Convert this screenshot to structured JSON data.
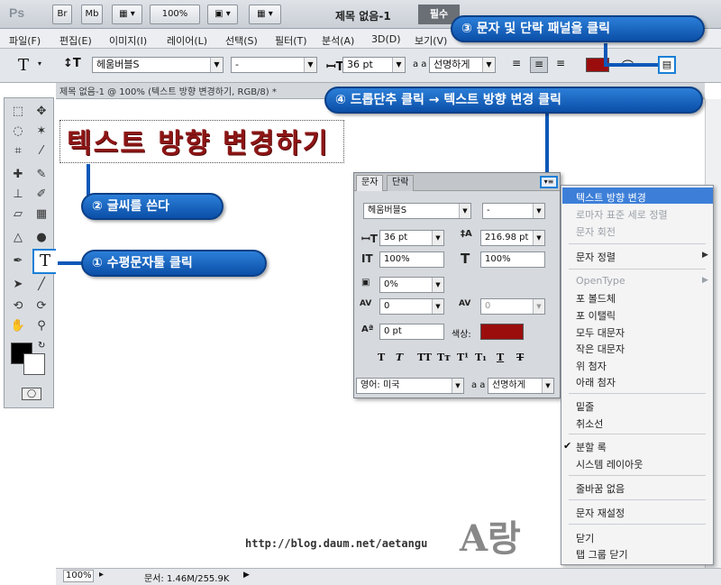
{
  "titlebar": {
    "logo": "Ps",
    "buttons": [
      "Br",
      "Mb",
      "▦ ▾",
      "100%",
      "▣ ▾",
      "▦ ▾"
    ],
    "doc_title": "제목 없음-1",
    "workspace": "필수"
  },
  "menu": [
    "파일(F)",
    "편집(E)",
    "이미지(I)",
    "레이어(L)",
    "선택(S)",
    "필터(T)",
    "분석(A)",
    "3D(D)",
    "보기(V)"
  ],
  "options": {
    "tool_glyph": "T",
    "font_family": "헤움버블S",
    "font_style": "-",
    "font_size": "36 pt",
    "aa_label": "a a",
    "antialias": "선명하게",
    "color": "#9b0d0d"
  },
  "document_tab": "제목 없음-1 @ 100% (텍스트 방향 변경하기, RGB/8) *",
  "sample_text": "텍스트 방향 변경하기",
  "callouts": {
    "c1": "① 수평문자툴 클릭",
    "c2": "② 글씨를 쓴다",
    "c3": "③ 문자 및 단락 패널을 클릭",
    "c4": "④ 드롭단추 클릭 → 텍스트 방향 변경 클릭"
  },
  "character_panel": {
    "tab_char": "문자",
    "tab_para": "단락",
    "font_family": "헤움버블S",
    "font_style": "-",
    "font_size": "36 pt",
    "leading": "216.98 pt",
    "vscale": "100%",
    "hscale": "100%",
    "tsume": "0%",
    "kerning": "0",
    "tracking": "0",
    "baseline": "0 pt",
    "color_label": "색상:",
    "color": "#9b0d0d",
    "language": "영어: 미국",
    "aa_label": "a a",
    "antialias": "선명하게"
  },
  "flyout_menu": {
    "groups": [
      [
        {
          "label": "텍스트 방향 변경",
          "state": "highlighted"
        },
        {
          "label": "로마자 표준 세로 정렬",
          "state": "disabled"
        },
        {
          "label": "문자 회전",
          "state": "disabled"
        }
      ],
      [
        {
          "label": "문자 정렬",
          "state": "submenu"
        }
      ],
      [
        {
          "label": "OpenType",
          "state": "submenu-disabled"
        },
        {
          "label": "포 볼드체",
          "state": "normal"
        },
        {
          "label": "포 이탤릭",
          "state": "normal"
        },
        {
          "label": "모두 대문자",
          "state": "normal"
        },
        {
          "label": "작은 대문자",
          "state": "normal"
        },
        {
          "label": "위 첨자",
          "state": "normal"
        },
        {
          "label": "아래 첨자",
          "state": "normal"
        }
      ],
      [
        {
          "label": "밑줄",
          "state": "normal"
        },
        {
          "label": "취소선",
          "state": "normal"
        }
      ],
      [
        {
          "label": "분할 록",
          "state": "checked"
        },
        {
          "label": "시스템 레이아웃",
          "state": "normal"
        }
      ],
      [
        {
          "label": "줄바꿈 없음",
          "state": "normal"
        }
      ],
      [
        {
          "label": "문자 재설정",
          "state": "normal"
        }
      ],
      [
        {
          "label": "닫기",
          "state": "normal"
        },
        {
          "label": "탭 그룹 닫기",
          "state": "normal"
        }
      ]
    ]
  },
  "statusbar": {
    "zoom": "100%",
    "doc_info": "문서: 1.46M/255.9K"
  },
  "watermark": {
    "url": "http://blog.daum.net/aetangu",
    "logo": "A랑"
  }
}
